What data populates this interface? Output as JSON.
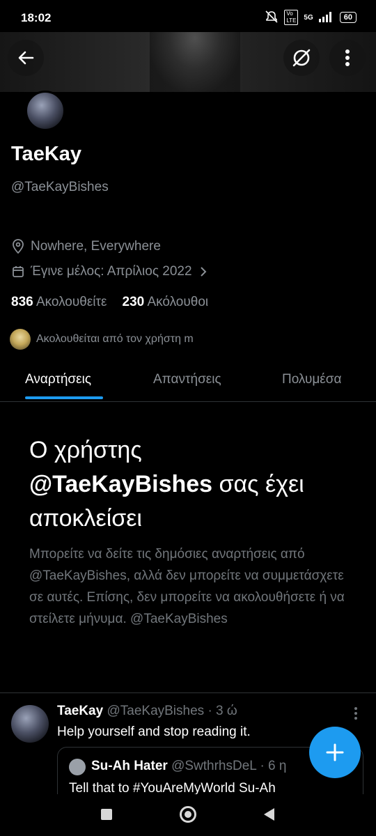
{
  "status_bar": {
    "time": "18:02",
    "network": "5G",
    "battery": "60"
  },
  "profile": {
    "name": "TaeKay",
    "handle": "@TaeKayBishes",
    "location": "Nowhere, Everywhere",
    "joined": "Έγινε μέλος: Απρίλιος 2022",
    "following_count": "836",
    "following_label": "Ακολουθείτε",
    "followers_count": "230",
    "followers_label": "Ακόλουθοι",
    "followed_by": "Ακολουθείται από τον χρήστη m"
  },
  "tabs": [
    {
      "label": "Αναρτήσεις"
    },
    {
      "label": "Απαντήσεις"
    },
    {
      "label": "Πολυμέσα"
    }
  ],
  "blocked": {
    "title_pre": "Ο χρήστης",
    "title_handle": "@TaeKayBishes",
    "title_post": " σας έχει αποκλείσει",
    "body": "Μπορείτε να δείτε τις δημόσιες αναρτήσεις από @TaeKayBishes, αλλά δεν μπορείτε να συμμετάσχετε σε αυτές. Επίσης, δεν μπορείτε να ακολουθήσετε ή να στείλετε μήνυμα. @TaeKayBishes"
  },
  "tweet": {
    "name": "TaeKay",
    "handle": "@TaeKayBishes",
    "time": "· 3 ώ",
    "text": "Help yourself and stop reading it.",
    "quote": {
      "name": "Su-Ah Hater",
      "handle": "@SwthrhsDeL",
      "time": "· 6 η",
      "text": "Tell that to #YouAreMyWorld Su-Ah"
    }
  },
  "colors": {
    "accent": "#1d9bf0",
    "background": "#000000",
    "muted": "#71767b"
  }
}
